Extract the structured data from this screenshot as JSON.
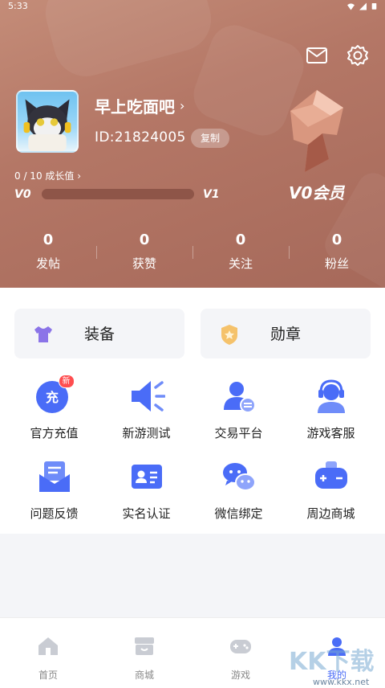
{
  "status_bar": {
    "time": "5:33"
  },
  "profile": {
    "username": "早上吃面吧",
    "user_id": "ID:21824005",
    "copy_label": "复制",
    "growth_text": "0 / 10 成长值",
    "growth_progress": 0.0,
    "level_current": "V0",
    "level_next": "V1",
    "vip_label": "V0会员"
  },
  "stats": [
    {
      "value": "0",
      "label": "发帖"
    },
    {
      "value": "0",
      "label": "获赞"
    },
    {
      "value": "0",
      "label": "关注"
    },
    {
      "value": "0",
      "label": "粉丝"
    }
  ],
  "cards": {
    "equip": "装备",
    "medal": "勋章"
  },
  "services": [
    {
      "label": "官方充值",
      "icon": "recharge-icon",
      "tag": "新",
      "glyph": "充"
    },
    {
      "label": "新游测试",
      "icon": "new-game-test-icon"
    },
    {
      "label": "交易平台",
      "icon": "trade-platform-icon"
    },
    {
      "label": "游戏客服",
      "icon": "customer-service-icon"
    },
    {
      "label": "问题反馈",
      "icon": "feedback-icon"
    },
    {
      "label": "实名认证",
      "icon": "id-verify-icon"
    },
    {
      "label": "微信绑定",
      "icon": "wechat-bind-icon"
    },
    {
      "label": "周边商城",
      "icon": "merch-store-icon"
    }
  ],
  "nav": [
    {
      "label": "首页",
      "icon": "home-icon"
    },
    {
      "label": "商城",
      "icon": "store-icon"
    },
    {
      "label": "游戏",
      "icon": "gamepad-icon"
    },
    {
      "label": "我的",
      "icon": "profile-icon",
      "active": true
    }
  ],
  "colors": {
    "accent": "#4a6cf7",
    "header": "#b47766"
  },
  "watermark": {
    "main": "KK下载",
    "sub": "www.kkx.net"
  }
}
